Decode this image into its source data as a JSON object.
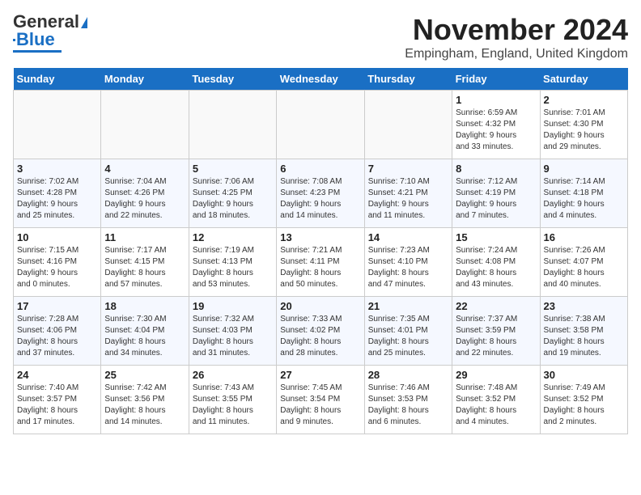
{
  "logo": {
    "text1": "General",
    "text2": "Blue"
  },
  "title": "November 2024",
  "location": "Empingham, England, United Kingdom",
  "days_of_week": [
    "Sunday",
    "Monday",
    "Tuesday",
    "Wednesday",
    "Thursday",
    "Friday",
    "Saturday"
  ],
  "weeks": [
    [
      {
        "day": "",
        "info": ""
      },
      {
        "day": "",
        "info": ""
      },
      {
        "day": "",
        "info": ""
      },
      {
        "day": "",
        "info": ""
      },
      {
        "day": "",
        "info": ""
      },
      {
        "day": "1",
        "info": "Sunrise: 6:59 AM\nSunset: 4:32 PM\nDaylight: 9 hours\nand 33 minutes."
      },
      {
        "day": "2",
        "info": "Sunrise: 7:01 AM\nSunset: 4:30 PM\nDaylight: 9 hours\nand 29 minutes."
      }
    ],
    [
      {
        "day": "3",
        "info": "Sunrise: 7:02 AM\nSunset: 4:28 PM\nDaylight: 9 hours\nand 25 minutes."
      },
      {
        "day": "4",
        "info": "Sunrise: 7:04 AM\nSunset: 4:26 PM\nDaylight: 9 hours\nand 22 minutes."
      },
      {
        "day": "5",
        "info": "Sunrise: 7:06 AM\nSunset: 4:25 PM\nDaylight: 9 hours\nand 18 minutes."
      },
      {
        "day": "6",
        "info": "Sunrise: 7:08 AM\nSunset: 4:23 PM\nDaylight: 9 hours\nand 14 minutes."
      },
      {
        "day": "7",
        "info": "Sunrise: 7:10 AM\nSunset: 4:21 PM\nDaylight: 9 hours\nand 11 minutes."
      },
      {
        "day": "8",
        "info": "Sunrise: 7:12 AM\nSunset: 4:19 PM\nDaylight: 9 hours\nand 7 minutes."
      },
      {
        "day": "9",
        "info": "Sunrise: 7:14 AM\nSunset: 4:18 PM\nDaylight: 9 hours\nand 4 minutes."
      }
    ],
    [
      {
        "day": "10",
        "info": "Sunrise: 7:15 AM\nSunset: 4:16 PM\nDaylight: 9 hours\nand 0 minutes."
      },
      {
        "day": "11",
        "info": "Sunrise: 7:17 AM\nSunset: 4:15 PM\nDaylight: 8 hours\nand 57 minutes."
      },
      {
        "day": "12",
        "info": "Sunrise: 7:19 AM\nSunset: 4:13 PM\nDaylight: 8 hours\nand 53 minutes."
      },
      {
        "day": "13",
        "info": "Sunrise: 7:21 AM\nSunset: 4:11 PM\nDaylight: 8 hours\nand 50 minutes."
      },
      {
        "day": "14",
        "info": "Sunrise: 7:23 AM\nSunset: 4:10 PM\nDaylight: 8 hours\nand 47 minutes."
      },
      {
        "day": "15",
        "info": "Sunrise: 7:24 AM\nSunset: 4:08 PM\nDaylight: 8 hours\nand 43 minutes."
      },
      {
        "day": "16",
        "info": "Sunrise: 7:26 AM\nSunset: 4:07 PM\nDaylight: 8 hours\nand 40 minutes."
      }
    ],
    [
      {
        "day": "17",
        "info": "Sunrise: 7:28 AM\nSunset: 4:06 PM\nDaylight: 8 hours\nand 37 minutes."
      },
      {
        "day": "18",
        "info": "Sunrise: 7:30 AM\nSunset: 4:04 PM\nDaylight: 8 hours\nand 34 minutes."
      },
      {
        "day": "19",
        "info": "Sunrise: 7:32 AM\nSunset: 4:03 PM\nDaylight: 8 hours\nand 31 minutes."
      },
      {
        "day": "20",
        "info": "Sunrise: 7:33 AM\nSunset: 4:02 PM\nDaylight: 8 hours\nand 28 minutes."
      },
      {
        "day": "21",
        "info": "Sunrise: 7:35 AM\nSunset: 4:01 PM\nDaylight: 8 hours\nand 25 minutes."
      },
      {
        "day": "22",
        "info": "Sunrise: 7:37 AM\nSunset: 3:59 PM\nDaylight: 8 hours\nand 22 minutes."
      },
      {
        "day": "23",
        "info": "Sunrise: 7:38 AM\nSunset: 3:58 PM\nDaylight: 8 hours\nand 19 minutes."
      }
    ],
    [
      {
        "day": "24",
        "info": "Sunrise: 7:40 AM\nSunset: 3:57 PM\nDaylight: 8 hours\nand 17 minutes."
      },
      {
        "day": "25",
        "info": "Sunrise: 7:42 AM\nSunset: 3:56 PM\nDaylight: 8 hours\nand 14 minutes."
      },
      {
        "day": "26",
        "info": "Sunrise: 7:43 AM\nSunset: 3:55 PM\nDaylight: 8 hours\nand 11 minutes."
      },
      {
        "day": "27",
        "info": "Sunrise: 7:45 AM\nSunset: 3:54 PM\nDaylight: 8 hours\nand 9 minutes."
      },
      {
        "day": "28",
        "info": "Sunrise: 7:46 AM\nSunset: 3:53 PM\nDaylight: 8 hours\nand 6 minutes."
      },
      {
        "day": "29",
        "info": "Sunrise: 7:48 AM\nSunset: 3:52 PM\nDaylight: 8 hours\nand 4 minutes."
      },
      {
        "day": "30",
        "info": "Sunrise: 7:49 AM\nSunset: 3:52 PM\nDaylight: 8 hours\nand 2 minutes."
      }
    ]
  ]
}
